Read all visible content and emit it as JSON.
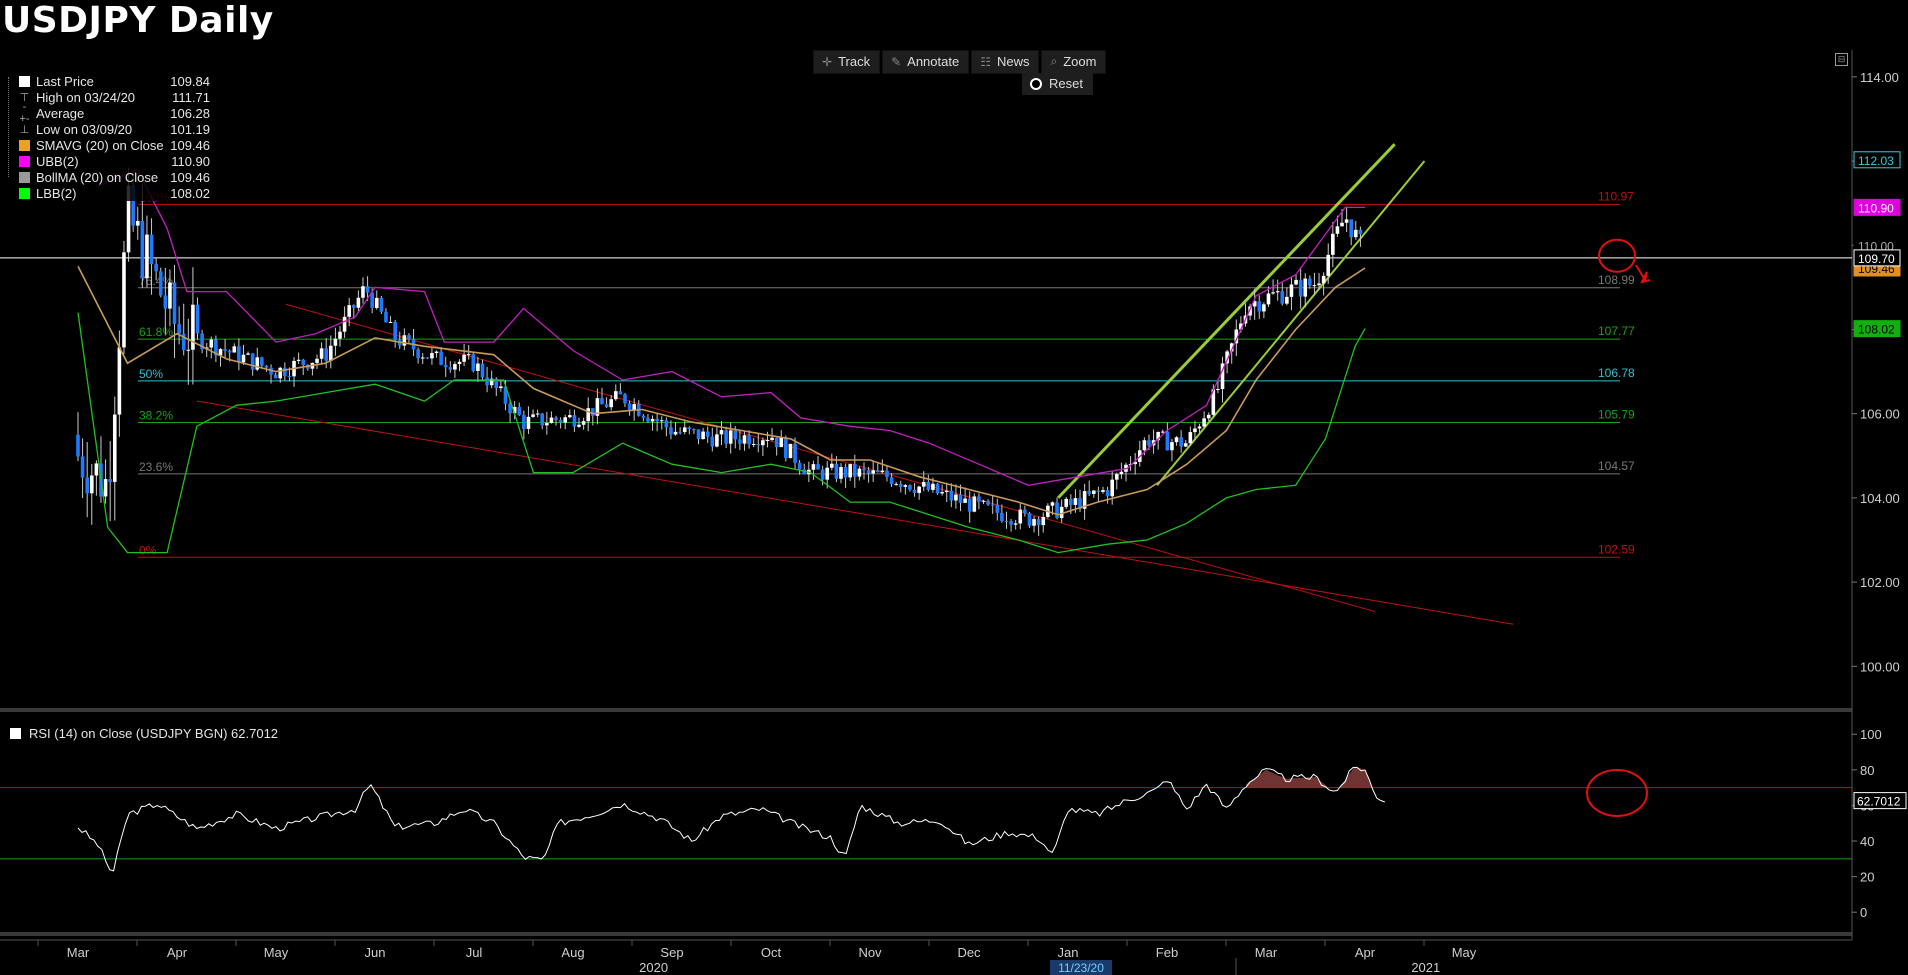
{
  "title": "USDJPY Daily",
  "toolbar": {
    "buttons": [
      {
        "label": "Track",
        "icon": "crosshair-icon",
        "glyph": "✛"
      },
      {
        "label": "Annotate",
        "icon": "pencil-icon",
        "glyph": "✎"
      },
      {
        "label": "News",
        "icon": "news-icon",
        "glyph": "☷"
      },
      {
        "label": "Zoom",
        "icon": "magnifier-icon",
        "glyph": "⌕"
      }
    ],
    "reset_label": "Reset"
  },
  "legend": [
    {
      "label": "Last Price",
      "value": "109.84",
      "color": "#ffffff",
      "kind": "swatch"
    },
    {
      "label": "High on 03/24/20",
      "value": "111.71",
      "kind": "symbol",
      "glyph": "⊤"
    },
    {
      "label": "Average",
      "value": "106.28",
      "kind": "symbol",
      "glyph": "-+-"
    },
    {
      "label": "Low on 03/09/20",
      "value": "101.19",
      "kind": "symbol",
      "glyph": "⊥"
    },
    {
      "label": "SMAVG (20)  on Close",
      "value": "109.46",
      "color": "#f0a020",
      "kind": "swatch"
    },
    {
      "label": "UBB(2)",
      "value": "110.90",
      "color": "#ff00ff",
      "kind": "swatch"
    },
    {
      "label": "BollMA (20)  on Close",
      "value": "109.46",
      "color": "#9a9a9a",
      "kind": "swatch"
    },
    {
      "label": "LBB(2)",
      "value": "108.02",
      "color": "#00ff00",
      "kind": "swatch"
    }
  ],
  "rsi_legend": "RSI (14)  on Close (USDJPY BGN) 62.7012",
  "colors": {
    "candle_up": "#ffffff",
    "candle_down": "#1e7bff",
    "sma": "#c89a5a",
    "ubb": "#c020c0",
    "lbb": "#20c020",
    "fib_red": "#c01010",
    "fib_green": "#1aa01a",
    "fib_cyan": "#30c0d0",
    "fib_gray": "#777777",
    "trend_green": "#9acd32",
    "circle": "#e01010"
  },
  "chart_data": {
    "type": "candlestick",
    "price_axis": {
      "ylim": [
        99.2,
        114.4
      ],
      "ticks": [
        "100.00",
        "102.00",
        "104.00",
        "106.00",
        "108.00",
        "110.00",
        "112.00",
        "114.00"
      ]
    },
    "x_labels": [
      {
        "label": "Mar",
        "month": 0
      },
      {
        "label": "Apr",
        "month": 1
      },
      {
        "label": "May",
        "month": 2
      },
      {
        "label": "Jun",
        "month": 3
      },
      {
        "label": "Jul",
        "month": 4
      },
      {
        "label": "Aug",
        "month": 5
      },
      {
        "label": "Sep",
        "month": 6
      },
      {
        "label": "Oct",
        "month": 7
      },
      {
        "label": "Nov",
        "month": 8
      },
      {
        "label": "Dec",
        "month": 9
      },
      {
        "label": "Jan",
        "month": 10
      },
      {
        "label": "Feb",
        "month": 11
      },
      {
        "label": "Mar",
        "month": 12
      },
      {
        "label": "Apr",
        "month": 13
      },
      {
        "label": "May",
        "month": 14
      }
    ],
    "years": [
      {
        "label": "2020",
        "month": 4.4
      },
      {
        "label": "2021",
        "month": 12.2
      }
    ],
    "cursor_date": "11/23/20",
    "fib_levels": [
      {
        "pct": "100%",
        "value": 110.97,
        "label": "110.97",
        "color": "#c01010"
      },
      {
        "pct": "76.4%",
        "value": 108.99,
        "label": "108.99",
        "color": "#777777"
      },
      {
        "pct": "61.8%",
        "value": 107.77,
        "label": "107.77",
        "color": "#1aa01a"
      },
      {
        "pct": "50%",
        "value": 106.78,
        "label": "106.78",
        "color": "#30c0d0"
      },
      {
        "pct": "38.2%",
        "value": 105.79,
        "label": "105.79",
        "color": "#1aa01a"
      },
      {
        "pct": "23.6%",
        "value": 104.57,
        "label": "104.57",
        "color": "#777777"
      },
      {
        "pct": "0%",
        "value": 102.59,
        "label": "102.59",
        "color": "#c01010"
      }
    ],
    "price_tags": [
      {
        "label": "112.03",
        "value": 112.03,
        "bg": "#000000",
        "fg": "#30d0e0",
        "border": "#30d0e0"
      },
      {
        "label": "110.90",
        "value": 110.9,
        "bg": "#e000e0",
        "fg": "#ffffff",
        "border": "#e000e0"
      },
      {
        "label": "110.00",
        "value": 110.0,
        "bg": "#000000",
        "fg": "#aaaaaa",
        "border": "#000000"
      },
      {
        "label": "109.46",
        "value": 109.46,
        "bg": "#e09020",
        "fg": "#000000",
        "border": "#e09020"
      },
      {
        "label": "109.70",
        "value": 109.7,
        "bg": "#000000",
        "fg": "#ffffff",
        "border": "#ffffff"
      },
      {
        "label": "108.02",
        "value": 108.02,
        "bg": "#10b010",
        "fg": "#000000",
        "border": "#10b010"
      }
    ],
    "current_line": 109.7,
    "monthly_close": [
      {
        "month": 0,
        "value": 105.0
      },
      {
        "month": 0.3,
        "value": 104.3
      },
      {
        "month": 0.5,
        "value": 110.7
      },
      {
        "month": 1.0,
        "value": 108.0
      },
      {
        "month": 1.5,
        "value": 107.5
      },
      {
        "month": 2.0,
        "value": 107.0
      },
      {
        "month": 2.5,
        "value": 107.4
      },
      {
        "month": 2.9,
        "value": 109.0
      },
      {
        "month": 3.2,
        "value": 107.8
      },
      {
        "month": 3.6,
        "value": 107.3
      },
      {
        "month": 4.0,
        "value": 107.2
      },
      {
        "month": 4.5,
        "value": 105.8
      },
      {
        "month": 5.0,
        "value": 105.9
      },
      {
        "month": 5.5,
        "value": 106.4
      },
      {
        "month": 6.0,
        "value": 105.6
      },
      {
        "month": 6.5,
        "value": 105.4
      },
      {
        "month": 7.0,
        "value": 105.5
      },
      {
        "month": 7.4,
        "value": 104.6
      },
      {
        "month": 7.8,
        "value": 104.6
      },
      {
        "month": 8.2,
        "value": 104.5
      },
      {
        "month": 8.7,
        "value": 104.1
      },
      {
        "month": 9.2,
        "value": 103.7
      },
      {
        "month": 9.6,
        "value": 103.5
      },
      {
        "month": 10.0,
        "value": 103.8
      },
      {
        "month": 10.4,
        "value": 104.2
      },
      {
        "month": 10.8,
        "value": 105.4
      },
      {
        "month": 11.2,
        "value": 105.3
      },
      {
        "month": 11.5,
        "value": 106.5
      },
      {
        "month": 11.8,
        "value": 108.6
      },
      {
        "month": 12.2,
        "value": 108.9
      },
      {
        "month": 12.5,
        "value": 109.1
      },
      {
        "month": 12.8,
        "value": 110.7
      },
      {
        "month": 13.0,
        "value": 109.8
      }
    ],
    "sma": [
      {
        "month": 0,
        "value": 109.5
      },
      {
        "month": 0.5,
        "value": 107.2
      },
      {
        "month": 1.0,
        "value": 107.9
      },
      {
        "month": 1.5,
        "value": 107.3
      },
      {
        "month": 2.0,
        "value": 107.0
      },
      {
        "month": 2.5,
        "value": 107.2
      },
      {
        "month": 3.0,
        "value": 107.8
      },
      {
        "month": 3.5,
        "value": 107.6
      },
      {
        "month": 4.2,
        "value": 107.4
      },
      {
        "month": 4.6,
        "value": 106.6
      },
      {
        "month": 5.2,
        "value": 106.0
      },
      {
        "month": 5.7,
        "value": 106.1
      },
      {
        "month": 6.2,
        "value": 105.8
      },
      {
        "month": 6.7,
        "value": 105.6
      },
      {
        "month": 7.2,
        "value": 105.4
      },
      {
        "month": 7.6,
        "value": 104.9
      },
      {
        "month": 8.0,
        "value": 104.9
      },
      {
        "month": 8.5,
        "value": 104.5
      },
      {
        "month": 9.0,
        "value": 104.2
      },
      {
        "month": 9.5,
        "value": 103.9
      },
      {
        "month": 9.9,
        "value": 103.6
      },
      {
        "month": 10.3,
        "value": 103.9
      },
      {
        "month": 10.8,
        "value": 104.2
      },
      {
        "month": 11.2,
        "value": 104.8
      },
      {
        "month": 11.6,
        "value": 105.6
      },
      {
        "month": 11.9,
        "value": 106.8
      },
      {
        "month": 12.3,
        "value": 108.0
      },
      {
        "month": 12.7,
        "value": 109.0
      },
      {
        "month": 13.0,
        "value": 109.46
      }
    ],
    "ubb": [
      {
        "month": 0.2,
        "value": 111.4
      },
      {
        "month": 0.6,
        "value": 111.8
      },
      {
        "month": 0.9,
        "value": 110.4
      },
      {
        "month": 1.1,
        "value": 108.9
      },
      {
        "month": 1.5,
        "value": 108.9
      },
      {
        "month": 2.0,
        "value": 107.7
      },
      {
        "month": 2.4,
        "value": 107.9
      },
      {
        "month": 2.8,
        "value": 108.3
      },
      {
        "month": 3.0,
        "value": 109.0
      },
      {
        "month": 3.5,
        "value": 108.9
      },
      {
        "month": 3.7,
        "value": 107.7
      },
      {
        "month": 4.2,
        "value": 107.7
      },
      {
        "month": 4.5,
        "value": 108.5
      },
      {
        "month": 5.0,
        "value": 107.5
      },
      {
        "month": 5.5,
        "value": 106.8
      },
      {
        "month": 6.0,
        "value": 107.0
      },
      {
        "month": 6.5,
        "value": 106.4
      },
      {
        "month": 7.0,
        "value": 106.5
      },
      {
        "month": 7.3,
        "value": 105.9
      },
      {
        "month": 7.8,
        "value": 105.7
      },
      {
        "month": 8.2,
        "value": 105.6
      },
      {
        "month": 8.6,
        "value": 105.3
      },
      {
        "month": 9.1,
        "value": 104.8
      },
      {
        "month": 9.6,
        "value": 104.3
      },
      {
        "month": 10.1,
        "value": 104.5
      },
      {
        "month": 10.6,
        "value": 104.7
      },
      {
        "month": 11.0,
        "value": 105.6
      },
      {
        "month": 11.4,
        "value": 106.2
      },
      {
        "month": 11.9,
        "value": 108.8
      },
      {
        "month": 12.3,
        "value": 109.3
      },
      {
        "month": 12.8,
        "value": 110.9
      },
      {
        "month": 13.0,
        "value": 110.9
      }
    ],
    "lbb": [
      {
        "month": 0,
        "value": 108.4
      },
      {
        "month": 0.3,
        "value": 103.3
      },
      {
        "month": 0.5,
        "value": 102.7
      },
      {
        "month": 0.9,
        "value": 102.7
      },
      {
        "month": 1.2,
        "value": 105.7
      },
      {
        "month": 1.6,
        "value": 106.2
      },
      {
        "month": 2.0,
        "value": 106.3
      },
      {
        "month": 2.5,
        "value": 106.5
      },
      {
        "month": 3.0,
        "value": 106.7
      },
      {
        "month": 3.5,
        "value": 106.3
      },
      {
        "month": 3.8,
        "value": 106.8
      },
      {
        "month": 4.3,
        "value": 106.8
      },
      {
        "month": 4.6,
        "value": 104.6
      },
      {
        "month": 5.0,
        "value": 104.6
      },
      {
        "month": 5.5,
        "value": 105.3
      },
      {
        "month": 6.0,
        "value": 104.8
      },
      {
        "month": 6.5,
        "value": 104.6
      },
      {
        "month": 7.0,
        "value": 104.8
      },
      {
        "month": 7.4,
        "value": 104.6
      },
      {
        "month": 7.8,
        "value": 103.9
      },
      {
        "month": 8.2,
        "value": 103.9
      },
      {
        "month": 8.6,
        "value": 103.6
      },
      {
        "month": 9.0,
        "value": 103.3
      },
      {
        "month": 9.5,
        "value": 103.0
      },
      {
        "month": 9.9,
        "value": 102.7
      },
      {
        "month": 10.4,
        "value": 102.9
      },
      {
        "month": 10.8,
        "value": 103.0
      },
      {
        "month": 11.2,
        "value": 103.4
      },
      {
        "month": 11.6,
        "value": 104.0
      },
      {
        "month": 11.9,
        "value": 104.2
      },
      {
        "month": 12.3,
        "value": 104.3
      },
      {
        "month": 12.6,
        "value": 105.4
      },
      {
        "month": 12.9,
        "value": 107.6
      },
      {
        "month": 13.0,
        "value": 108.02
      }
    ],
    "trendlines": [
      {
        "name": "upper-red",
        "color": "#c01010",
        "from": [
          2.1,
          108.6
        ],
        "to": [
          13.1,
          101.3
        ]
      },
      {
        "name": "lower-red",
        "color": "#c01010",
        "from": [
          1.2,
          106.3
        ],
        "to": [
          14.5,
          101.0
        ]
      },
      {
        "name": "green-upper",
        "color": "#9acd32",
        "from": [
          9.9,
          104.0
        ],
        "to": [
          13.3,
          112.4
        ]
      },
      {
        "name": "green-lower",
        "color": "#9acd32",
        "from": [
          10.9,
          104.3
        ],
        "to": [
          13.6,
          112.0
        ]
      }
    ],
    "rsi": {
      "axis": {
        "ylim": [
          -10,
          108
        ],
        "ticks": [
          "0",
          "20",
          "40",
          "60",
          "80",
          "100"
        ]
      },
      "overbought": 70,
      "oversold": 30,
      "last": "62.7012",
      "values": [
        {
          "month": 0,
          "value": 48
        },
        {
          "month": 0.2,
          "value": 38
        },
        {
          "month": 0.35,
          "value": 21
        },
        {
          "month": 0.5,
          "value": 55
        },
        {
          "month": 0.8,
          "value": 61
        },
        {
          "month": 1.2,
          "value": 47
        },
        {
          "month": 1.6,
          "value": 55
        },
        {
          "month": 2.0,
          "value": 47
        },
        {
          "month": 2.4,
          "value": 53
        },
        {
          "month": 2.8,
          "value": 58
        },
        {
          "month": 2.95,
          "value": 72
        },
        {
          "month": 3.2,
          "value": 48
        },
        {
          "month": 3.6,
          "value": 50
        },
        {
          "month": 3.9,
          "value": 58
        },
        {
          "month": 4.2,
          "value": 50
        },
        {
          "month": 4.5,
          "value": 31
        },
        {
          "month": 4.7,
          "value": 29
        },
        {
          "month": 4.85,
          "value": 50
        },
        {
          "month": 5.2,
          "value": 55
        },
        {
          "month": 5.5,
          "value": 61
        },
        {
          "month": 5.9,
          "value": 52
        },
        {
          "month": 6.2,
          "value": 40
        },
        {
          "month": 6.5,
          "value": 54
        },
        {
          "month": 6.9,
          "value": 58
        },
        {
          "month": 7.3,
          "value": 48
        },
        {
          "month": 7.6,
          "value": 42
        },
        {
          "month": 7.75,
          "value": 30
        },
        {
          "month": 7.9,
          "value": 60
        },
        {
          "month": 8.3,
          "value": 50
        },
        {
          "month": 8.7,
          "value": 52
        },
        {
          "month": 9.0,
          "value": 38
        },
        {
          "month": 9.4,
          "value": 45
        },
        {
          "month": 9.7,
          "value": 42
        },
        {
          "month": 9.85,
          "value": 32
        },
        {
          "month": 10.0,
          "value": 58
        },
        {
          "month": 10.3,
          "value": 55
        },
        {
          "month": 10.6,
          "value": 63
        },
        {
          "month": 10.9,
          "value": 69
        },
        {
          "month": 11.0,
          "value": 75
        },
        {
          "month": 11.2,
          "value": 58
        },
        {
          "month": 11.4,
          "value": 72
        },
        {
          "month": 11.6,
          "value": 58
        },
        {
          "month": 11.8,
          "value": 72
        },
        {
          "month": 12.0,
          "value": 80
        },
        {
          "month": 12.2,
          "value": 75
        },
        {
          "month": 12.5,
          "value": 76
        },
        {
          "month": 12.7,
          "value": 67
        },
        {
          "month": 12.9,
          "value": 82
        },
        {
          "month": 13.0,
          "value": 80
        },
        {
          "month": 13.1,
          "value": 66
        },
        {
          "month": 13.2,
          "value": 62.7
        }
      ]
    }
  }
}
